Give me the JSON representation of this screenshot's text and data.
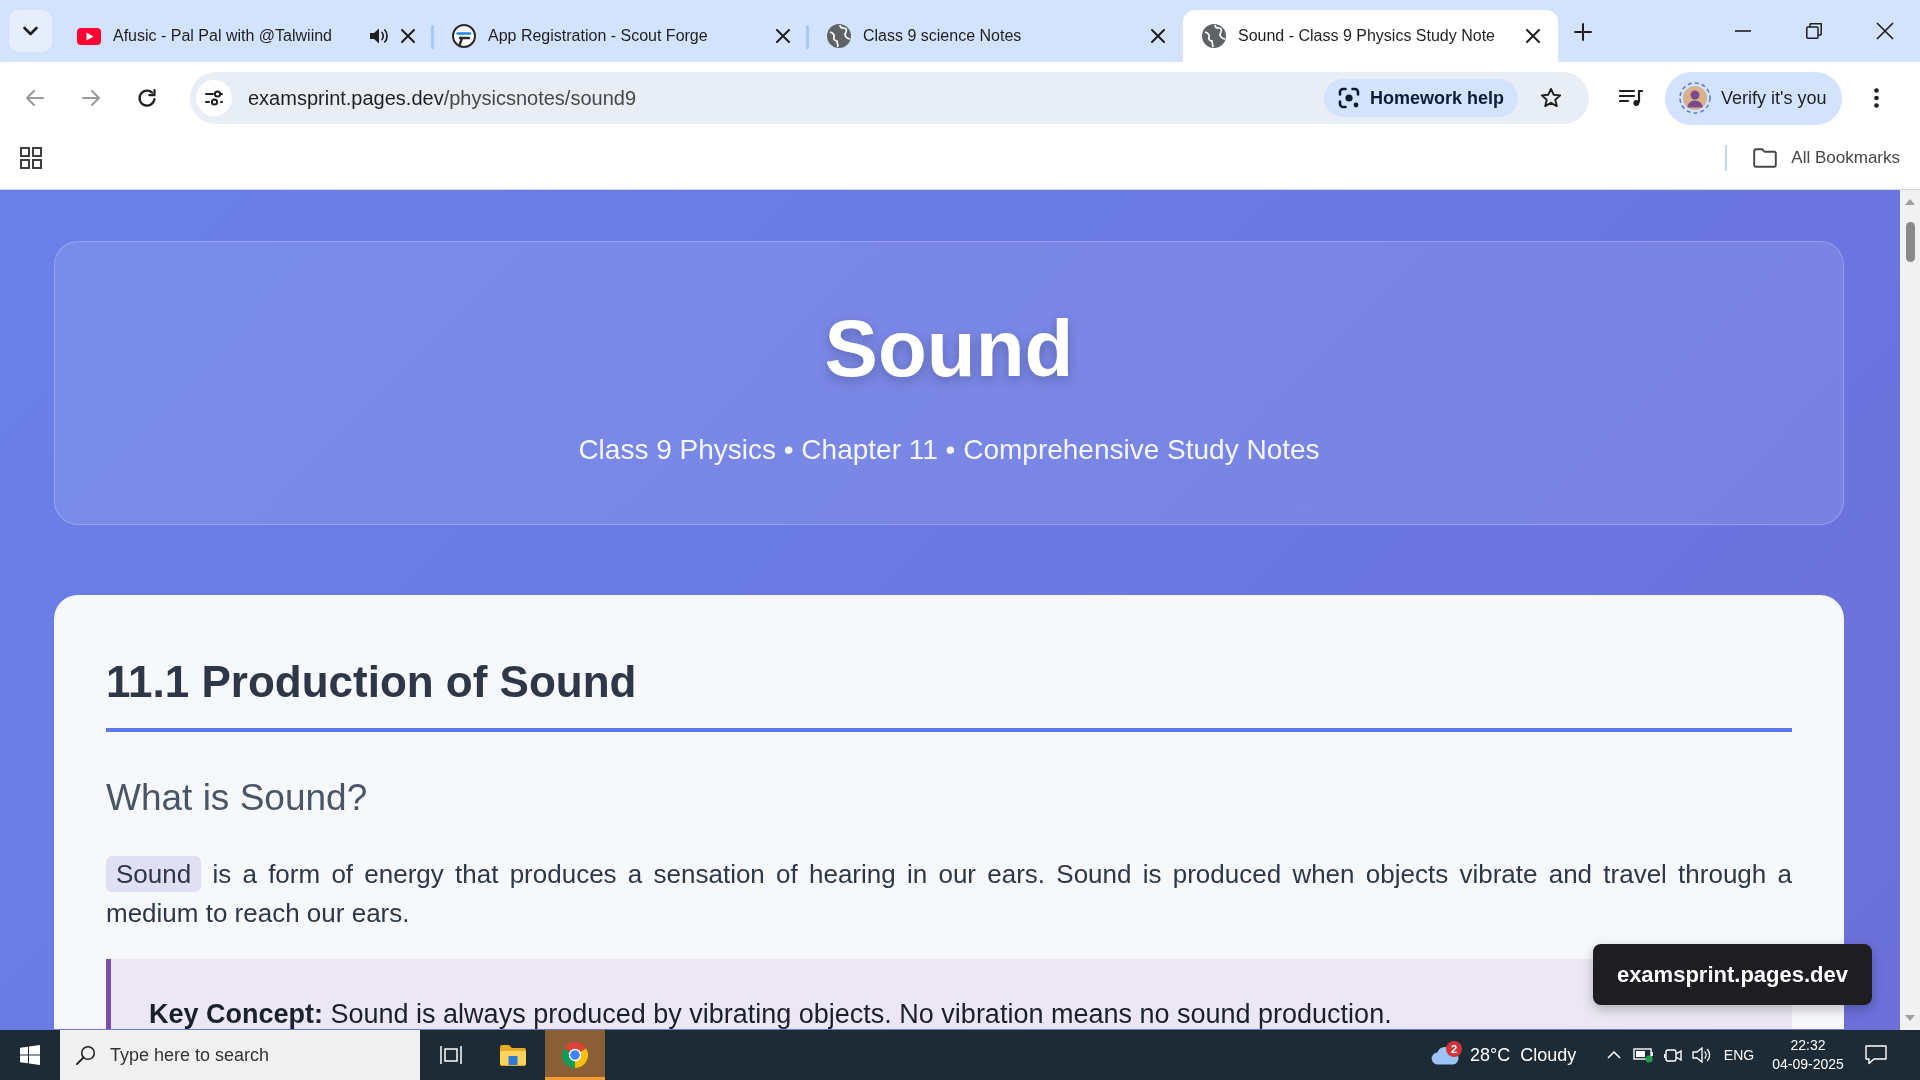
{
  "browser": {
    "tabs": [
      {
        "kind": "video",
        "title": "Afusic - Pal Pal with @Talwiind",
        "audio": true,
        "selected": false
      },
      {
        "kind": "app",
        "title": "App Registration - Scout Forge",
        "audio": false,
        "selected": false
      },
      {
        "kind": "web",
        "title": "Class 9 science Notes",
        "audio": false,
        "selected": false
      },
      {
        "kind": "web",
        "title": "Sound - Class 9 Physics Study Note",
        "audio": false,
        "selected": true
      }
    ],
    "navigation": [
      {
        "kind": "back",
        "disabled": true
      },
      {
        "kind": "forward",
        "disabled": true
      },
      {
        "kind": "reload",
        "disabled": false
      }
    ],
    "address_bar": {
      "host": "examsprint.pages.dev",
      "path": "/physicsnotes/sound9"
    },
    "homework_button": "Homework help",
    "profile_button": "Verify it's you",
    "bookmarks_button": "All Bookmarks"
  },
  "page": {
    "header": {
      "title": "Sound",
      "subtitle": "Class 9 Physics • Chapter 11 • Comprehensive Study Notes"
    },
    "section": {
      "heading": "11.1 Production of Sound",
      "subheading": "What is Sound?",
      "paragraph": {
        "term": "Sound",
        "text": "is a form of energy that produces a sensation of hearing in our ears. Sound is produced when objects vibrate and travel through a medium to reach our ears."
      },
      "key_concept": "**Key Concept:** Sound is always produced by vibrating objects. No vibration means no sound production."
    },
    "site_badge": "examsprint.pages.dev"
  },
  "taskbar": {
    "search": {
      "placeholder": "Type here to search"
    },
    "apps": [
      {
        "kind": "task_view",
        "selected": false
      },
      {
        "kind": "file_explorer",
        "selected": false
      },
      {
        "kind": "browser",
        "selected": true
      }
    ],
    "weather": {
      "alerts": "2",
      "temperature": "28°C",
      "condition": "Cloudy"
    },
    "language": "ENG",
    "time": "22:32",
    "date": "04-09-2025"
  }
}
